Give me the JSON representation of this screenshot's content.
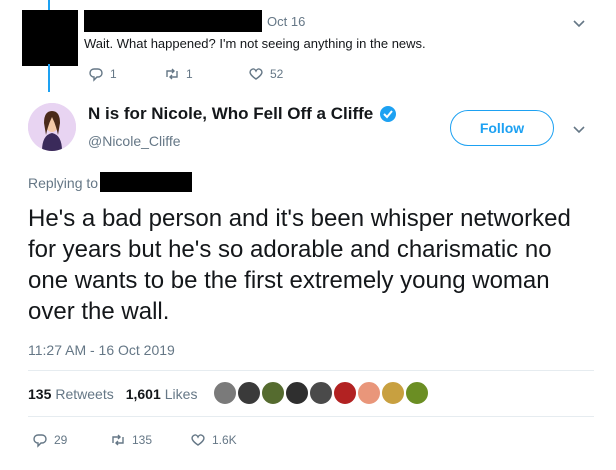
{
  "prev_tweet": {
    "date": "Oct 16",
    "text": "Wait. What happened? I'm not seeing anything in the news.",
    "reply_count": "1",
    "retweet_count": "1",
    "like_count": "52"
  },
  "main_tweet": {
    "display_name": "N is for Nicole, Who Fell Off a Cliffe",
    "handle": "@Nicole_Cliffe",
    "follow_label": "Follow",
    "replying_label": "Replying to",
    "text": "He's a bad person and it's been whisper networked for years but he's so adorable and charismatic no one wants to be the first extremely young woman over the wall.",
    "timestamp": "11:27 AM - 16 Oct 2019",
    "retweets_count": "135",
    "retweets_label": "Retweets",
    "likes_count": "1,601",
    "likes_label": "Likes",
    "reply_count": "29",
    "retweet_count": "135",
    "like_count": "1.6K"
  },
  "colors": {
    "accent": "#1da1f2",
    "muted": "#657786",
    "text": "#14171a"
  },
  "likers": [
    "#7a7a7a",
    "#3a3a3a",
    "#556b2f",
    "#2f2f2f",
    "#4a4a4a",
    "#b22222",
    "#e9967a",
    "#c8a040",
    "#6b8e23"
  ]
}
